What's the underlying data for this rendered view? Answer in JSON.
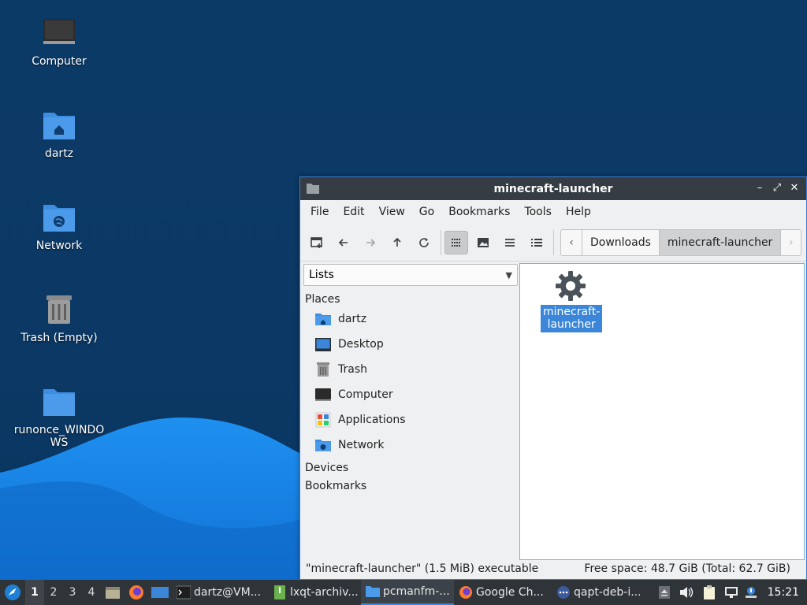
{
  "desktop": {
    "icons": [
      {
        "label": "Computer",
        "icon": "computer-icon"
      },
      {
        "label": "dartz",
        "icon": "home-folder-icon"
      },
      {
        "label": "Network",
        "icon": "network-folder-icon"
      },
      {
        "label": "Trash (Empty)",
        "icon": "trash-icon"
      },
      {
        "label": "runonce_WINDOWS",
        "icon": "folder-icon"
      }
    ]
  },
  "window": {
    "title": "minecraft-launcher",
    "controls": {
      "minimize": "–",
      "maximize": "⤢",
      "close": "✕"
    },
    "menu": [
      "File",
      "Edit",
      "View",
      "Go",
      "Bookmarks",
      "Tools",
      "Help"
    ],
    "path": [
      "Downloads",
      "minecraft-launcher"
    ],
    "sidebar": {
      "mode": "Lists",
      "places_header": "Places",
      "places": [
        {
          "label": "dartz",
          "icon": "home-folder-icon"
        },
        {
          "label": "Desktop",
          "icon": "desktop-icon"
        },
        {
          "label": "Trash",
          "icon": "trash-icon"
        },
        {
          "label": "Computer",
          "icon": "computer-icon"
        },
        {
          "label": "Applications",
          "icon": "applications-icon"
        },
        {
          "label": "Network",
          "icon": "network-folder-icon"
        }
      ],
      "devices_header": "Devices",
      "bookmarks_header": "Bookmarks"
    },
    "files": [
      {
        "name": "minecraft-launcher",
        "icon": "gear-icon",
        "selected": true
      }
    ],
    "status": {
      "left": "\"minecraft-launcher\" (1.5 MiB) executable",
      "right": "Free space: 48.7 GiB (Total: 62.7 GiB)"
    }
  },
  "taskbar": {
    "workspaces": [
      "1",
      "2",
      "3",
      "4"
    ],
    "tasks": [
      {
        "label": "dartz@VM...",
        "icon": "terminal-icon"
      },
      {
        "label": "lxqt-archiv...",
        "icon": "archive-icon"
      },
      {
        "label": "pcmanfm-...",
        "icon": "folder-icon",
        "active": true
      },
      {
        "label": "Google Ch...",
        "icon": "firefox-icon"
      },
      {
        "label": "qapt-deb-i...",
        "icon": "package-icon"
      }
    ],
    "clock": "15:21"
  },
  "colors": {
    "desktop_bg": "#0c3a67",
    "accent": "#3b86d8",
    "titlebar": "#353c44",
    "taskbar": "#2f3439"
  }
}
